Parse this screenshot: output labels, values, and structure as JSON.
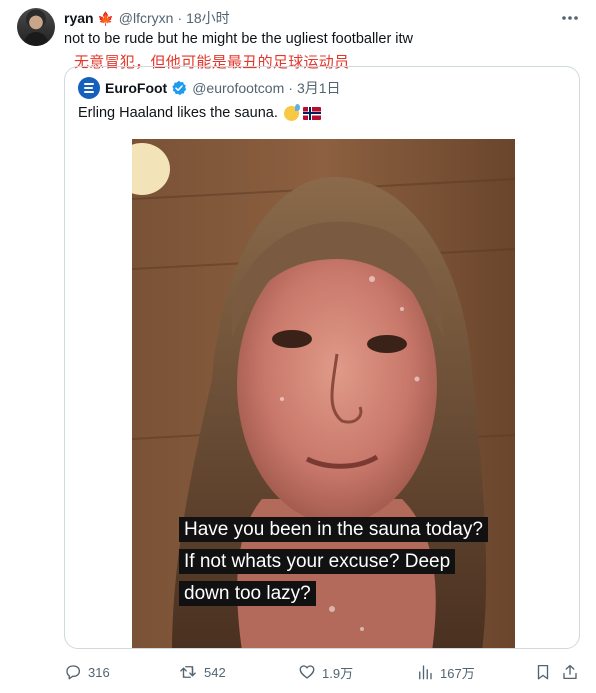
{
  "tweet": {
    "author_name": "ryan",
    "author_flag_icon": "maple-leaf-icon",
    "handle": "@lfcryxn",
    "separator": "·",
    "time": "18小时",
    "text": "not to be rude but he might be the ugliest footballer itw",
    "translation": "无意冒犯，但他可能是最丑的足球运动员"
  },
  "quote": {
    "author_name": "EuroFoot",
    "handle": "@eurofootcom",
    "separator": "·",
    "time": "3月1日",
    "text": "Erling Haaland likes the sauna.",
    "emojis": [
      "grinning-sweat-emoji",
      "norway-flag-emoji"
    ],
    "image_caption": "Have you been in the sauna today? If not whats your excuse? Deep down too lazy?"
  },
  "actions": {
    "replies": "316",
    "retweets": "542",
    "likes": "1.9万",
    "views": "167万"
  },
  "colors": {
    "accent": "#1d9bf0",
    "secondary_text": "#536471",
    "translation_red": "#e5362b",
    "border": "#cfd9de"
  }
}
